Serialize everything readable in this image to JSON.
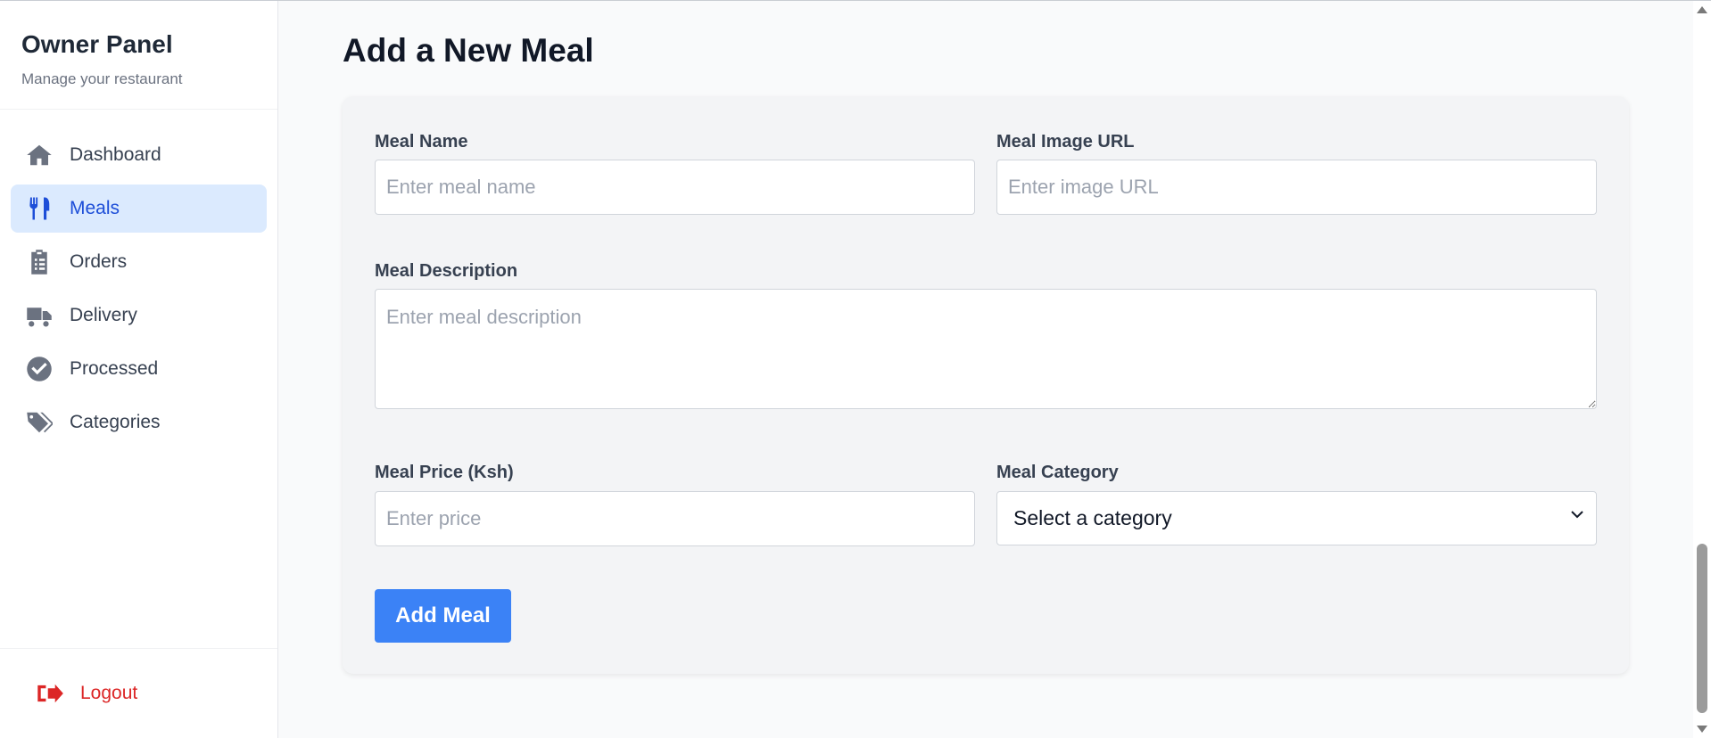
{
  "sidebar": {
    "title": "Owner Panel",
    "subtitle": "Manage your restaurant",
    "items": [
      {
        "label": "Dashboard",
        "icon": "home-icon",
        "active": false
      },
      {
        "label": "Meals",
        "icon": "utensils-icon",
        "active": true
      },
      {
        "label": "Orders",
        "icon": "clipboard-icon",
        "active": false
      },
      {
        "label": "Delivery",
        "icon": "truck-icon",
        "active": false
      },
      {
        "label": "Processed",
        "icon": "check-circle-icon",
        "active": false
      },
      {
        "label": "Categories",
        "icon": "tags-icon",
        "active": false
      }
    ],
    "logout_label": "Logout"
  },
  "main": {
    "title": "Add a New Meal",
    "form": {
      "name_label": "Meal Name",
      "name_placeholder": "Enter meal name",
      "image_label": "Meal Image URL",
      "image_placeholder": "Enter image URL",
      "description_label": "Meal Description",
      "description_placeholder": "Enter meal description",
      "price_label": "Meal Price (Ksh)",
      "price_placeholder": "Enter price",
      "category_label": "Meal Category",
      "category_selected": "Select a category",
      "submit_label": "Add Meal"
    }
  },
  "colors": {
    "accent": "#3b82f6",
    "active_bg": "#dbeafe",
    "active_text": "#1d4ed8",
    "danger": "#dc2626"
  }
}
